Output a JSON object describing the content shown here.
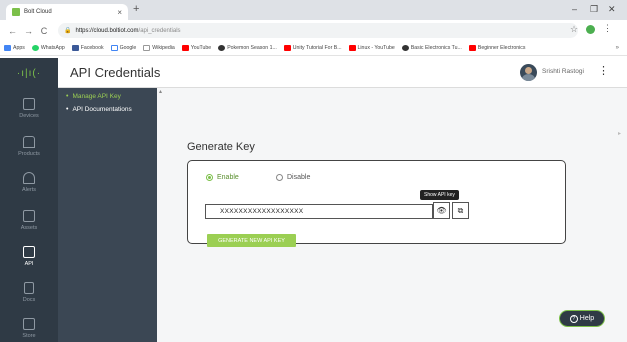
{
  "browser": {
    "tab_title": "Bolt Cloud",
    "tab_close": "×",
    "new_tab": "+",
    "url_host": "https://cloud.boltiot.com",
    "url_path": "/api_credentials",
    "win_min": "–",
    "win_max": "❐",
    "win_close": "✕",
    "nav_back": "←",
    "nav_fwd": "→",
    "nav_reload": "C",
    "bookmarks": [
      {
        "label": "Apps",
        "color": "#4285f4"
      },
      {
        "label": "WhatsApp",
        "color": "#25d366"
      },
      {
        "label": "Facebook",
        "color": "#3b5998"
      },
      {
        "label": "Google",
        "color": "#ffffff"
      },
      {
        "label": "Wikipedia",
        "color": "#ffffff"
      },
      {
        "label": "YouTube",
        "color": "#ff0000"
      },
      {
        "label": "Pokemon Season 1...",
        "color": "#333333"
      },
      {
        "label": "Unity Tutorial For B...",
        "color": "#ff0000"
      },
      {
        "label": "Linux - YouTube",
        "color": "#ff0000"
      },
      {
        "label": "Basic Electronics Tu...",
        "color": "#333333"
      },
      {
        "label": "Beginner Electronics",
        "color": "#ff0000"
      }
    ],
    "bookmarks_more": "»"
  },
  "header": {
    "logo": "·ı|ı(·",
    "title": "API Credentials",
    "username": "Srishti Rastogi",
    "menu_icon": "⋮"
  },
  "sidebar": [
    {
      "label": "Devices"
    },
    {
      "label": "Products"
    },
    {
      "label": "Alerts"
    },
    {
      "label": "Assets"
    },
    {
      "label": "API"
    },
    {
      "label": "Docs"
    },
    {
      "label": "Store"
    }
  ],
  "subnav": [
    {
      "label": "Manage API Key",
      "color": "#9bcf53"
    },
    {
      "label": "API Documentations",
      "color": "#ffffff"
    }
  ],
  "main": {
    "section_title": "Generate Key",
    "radio_enable": "Enable",
    "radio_disable": "Disable",
    "api_key_value": "XXXXXXXXXXXXXXXXXX",
    "tooltip": "Show API key",
    "generate_button": "GENERATE NEW API KEY"
  },
  "help": {
    "label": "Help",
    "icon": "?"
  },
  "colors": {
    "accent": "#9bcf53",
    "sidebar": "#2f3a45",
    "subnav": "#3b4754"
  }
}
